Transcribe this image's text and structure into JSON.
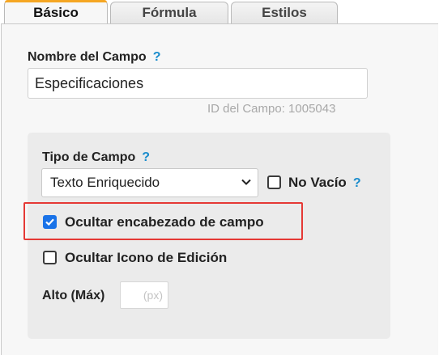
{
  "tabs": [
    {
      "label": "Básico",
      "active": true
    },
    {
      "label": "Fórmula",
      "active": false
    },
    {
      "label": "Estilos",
      "active": false
    }
  ],
  "colors": {
    "active_tab_accent": "#f5a623",
    "help": "#1a8ccc",
    "checkbox_checked": "#1a73e8",
    "highlight_border": "#e53935"
  },
  "field_name": {
    "label": "Nombre del Campo",
    "help": "?",
    "value": "Especificaciones",
    "field_id_text": "ID del Campo: 1005043"
  },
  "field_type": {
    "label": "Tipo de Campo",
    "help": "?",
    "selected": "Texto Enriquecido",
    "dropdown_icon": "chevron-down-icon"
  },
  "no_vacio": {
    "label": "No Vacío",
    "help": "?",
    "checked": false
  },
  "hide_header": {
    "label": "Ocultar encabezado de campo",
    "checked": true
  },
  "hide_edit_icon": {
    "label": "Ocultar Icono de Edición",
    "checked": false
  },
  "height": {
    "label": "Alto (Máx)",
    "placeholder": "(px)"
  }
}
